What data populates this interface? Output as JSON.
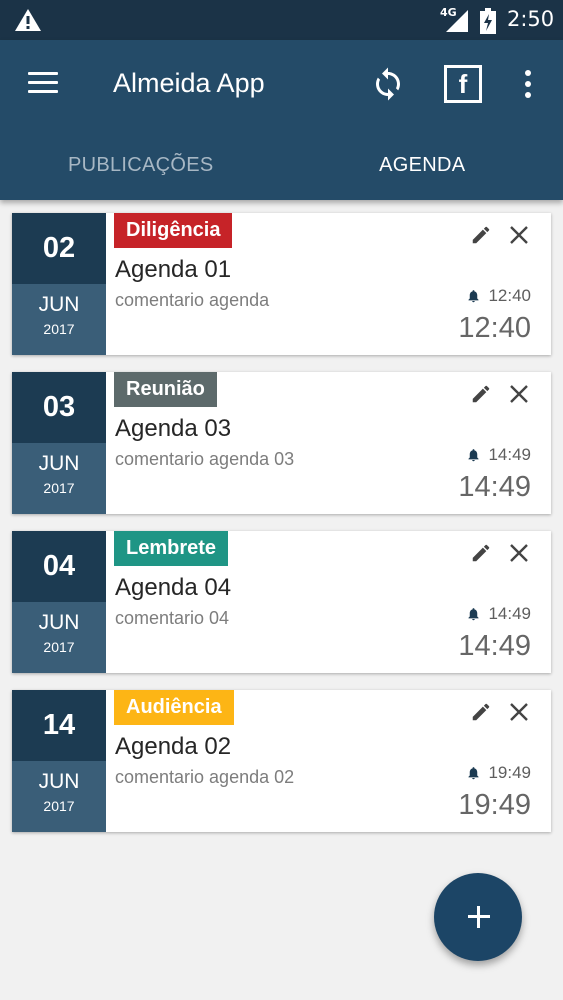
{
  "status_bar": {
    "network": "4G",
    "time": "2:50",
    "icons": [
      "warning-icon",
      "signal-icon",
      "battery-charging-icon"
    ]
  },
  "app_bar": {
    "title": "Almeida App",
    "icons": [
      "menu-icon",
      "sync-icon",
      "facebook-icon",
      "more-vert-icon"
    ],
    "facebook_glyph": "f"
  },
  "tabs": [
    {
      "label": "PUBLICAÇÕES",
      "active": false
    },
    {
      "label": "AGENDA",
      "active": true
    }
  ],
  "events": [
    {
      "day": "02",
      "month": "JUN",
      "year": "2017",
      "tag": "Diligência",
      "tag_color": "#c62328",
      "title": "Agenda 01",
      "comment": "comentario agenda",
      "alarm": "12:40",
      "time": "12:40"
    },
    {
      "day": "03",
      "month": "JUN",
      "year": "2017",
      "tag": "Reunião",
      "tag_color": "#5d6a6b",
      "title": "Agenda 03",
      "comment": "comentario agenda 03",
      "alarm": "14:49",
      "time": "14:49"
    },
    {
      "day": "04",
      "month": "JUN",
      "year": "2017",
      "tag": "Lembrete",
      "tag_color": "#1f9585",
      "title": "Agenda 04",
      "comment": "comentario 04",
      "alarm": "14:49",
      "time": "14:49"
    },
    {
      "day": "14",
      "month": "JUN",
      "year": "2017",
      "tag": "Audiência",
      "tag_color": "#fdb515",
      "title": "Agenda 02",
      "comment": "comentario agenda 02",
      "alarm": "19:49",
      "time": "19:49"
    }
  ],
  "fab": {
    "icon": "add-icon"
  },
  "colors": {
    "status_bar": "#1b3347",
    "app_bar": "#244b68",
    "date_top": "#1c3b52",
    "date_bottom": "#3a5e78",
    "fab": "#1c4566"
  }
}
